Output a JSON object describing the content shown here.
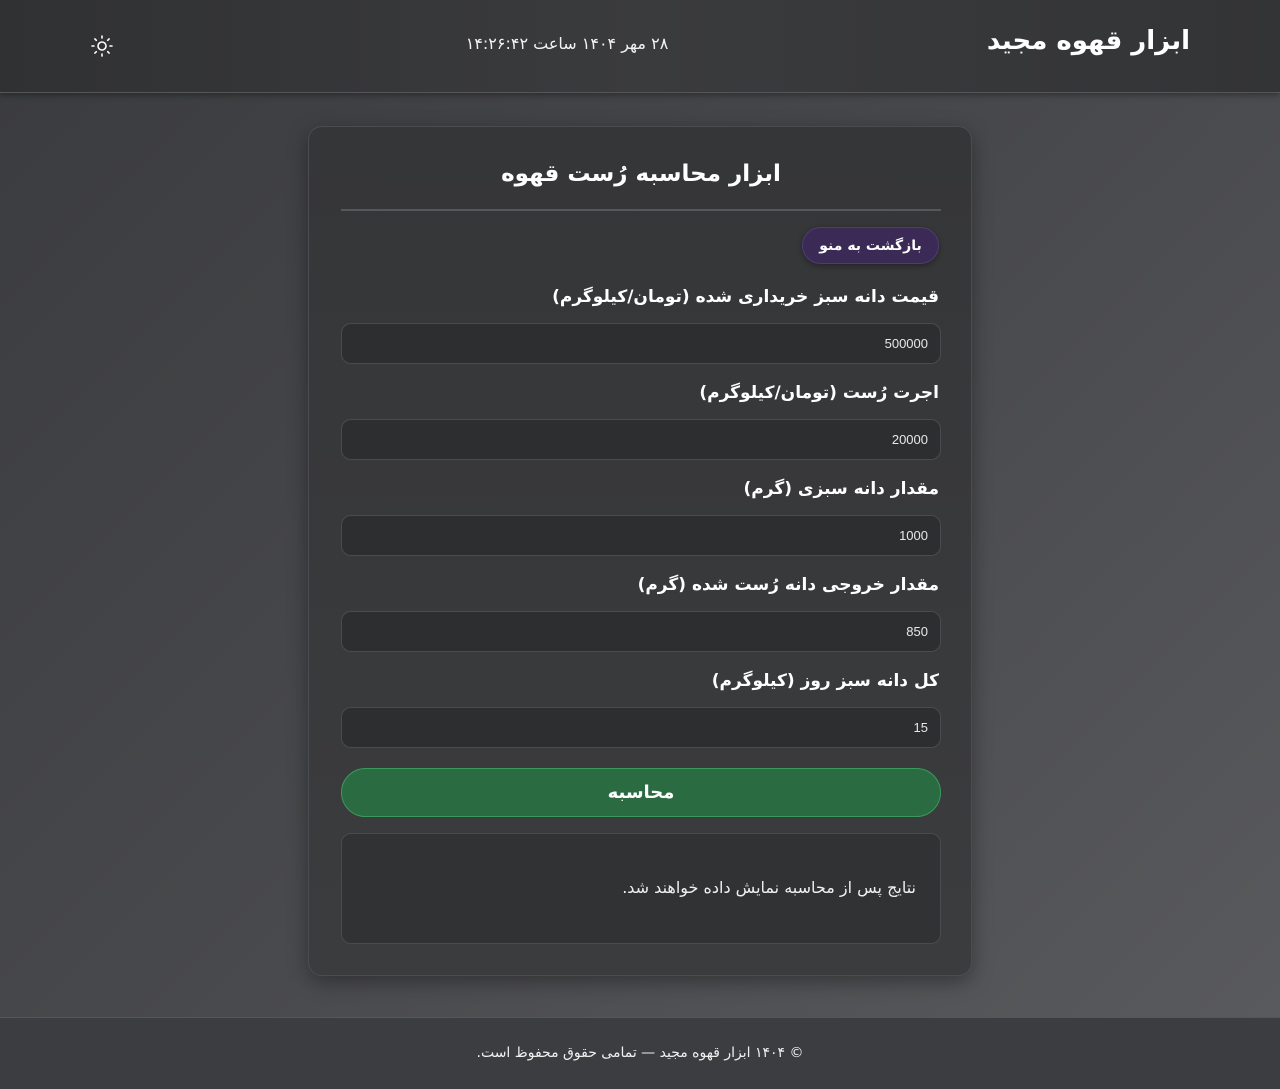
{
  "header": {
    "brand": "ابزار قهوه مجید",
    "datetime": "۲۸ مهر ۱۴۰۴ ساعت ۱۴:۲۶:۴۲",
    "theme_icon": "sun-icon"
  },
  "card": {
    "title": "ابزار محاسبه رُست قهوه",
    "back_label": "بازگشت به منو",
    "fields": [
      {
        "label": "قیمت دانه سبز خریداری شده (تومان/کیلوگرم)",
        "value": "500000"
      },
      {
        "label": "اجرت رُست (تومان/کیلوگرم)",
        "value": "20000"
      },
      {
        "label": "مقدار دانه سبزی (گرم)",
        "value": "1000"
      },
      {
        "label": "مقدار خروجی دانه رُست شده (گرم)",
        "value": "850"
      },
      {
        "label": "کل دانه سبز روز (کیلوگرم)",
        "value": "15"
      }
    ],
    "calculate_label": "محاسبه",
    "results_placeholder": "نتایج پس از محاسبه نمایش داده خواهند شد."
  },
  "footer": {
    "text": "© ۱۴۰۴ ابزار قهوه مجید — تمامی حقوق محفوظ است."
  },
  "colors": {
    "calculate_button": "#2a6b42",
    "back_button": "#3a2a55"
  }
}
